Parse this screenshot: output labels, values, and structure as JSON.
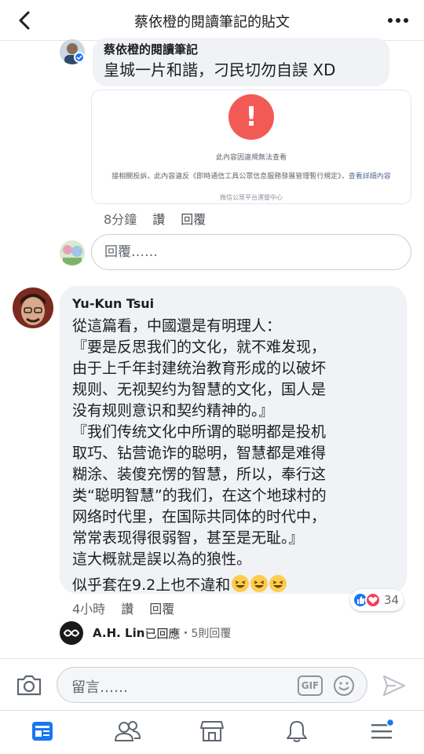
{
  "header": {
    "title": "蔡依橙的閱讀筆記的貼文"
  },
  "reply1": {
    "author": "蔡依橙的閱讀筆記",
    "text": "皇城一片和諧，刁民切勿自誤 XD",
    "embed": {
      "notice": "此內容因違規無法查看",
      "detail": "接相關投訴，此內容違反《即時通信工具公眾信息服務發展管理暫行規定》，",
      "detail_link": "查看詳細內容",
      "footer": "微信公眾平台運營中心"
    },
    "time": "8分鐘",
    "like_label": "讚",
    "reply_label": "回覆"
  },
  "reply_input": {
    "placeholder": "回覆……"
  },
  "comment": {
    "author": "Yu-Kun Tsui",
    "lines": [
      "從這篇看，中國還是有明理人：",
      "『要是反思我们的文化，就不难发现，",
      "由于上千年封建统治教育形成的以破坏",
      "规则、无视契约为智慧的文化，国人是",
      "没有规则意识和契约精神的。』",
      "『我们传统文化中所谓的聪明都是投机",
      "取巧、钻营诡诈的聪明，智慧都是难得",
      "糊涂、装傻充愣的智慧，所以，奉行这",
      "类“聪明智慧”的我们，在这个地球村的",
      "网络时代里，在国际共同体的时代中，",
      "常常表现得很弱智，甚至是无耻。』",
      "這大概就是誤以為的狼性。"
    ],
    "last_line": "似乎套在9.2上也不違和",
    "time": "4小時",
    "like_label": "讚",
    "reply_label": "回覆",
    "reaction_count": "34",
    "replies": {
      "name": "A.H. Lin",
      "action": "已回應",
      "count": "・5則回覆"
    }
  },
  "composer": {
    "placeholder": "留言……",
    "gif_label": "GIF"
  },
  "icons": {
    "back": "back-arrow-icon",
    "more": "more-dots-icon",
    "camera": "camera-icon",
    "gif": "gif-icon",
    "emoji": "emoji-icon",
    "send": "send-icon",
    "nav": [
      "news-feed-icon",
      "friends-icon",
      "marketplace-icon",
      "notifications-icon",
      "menu-icon"
    ]
  },
  "colors": {
    "accent": "#1877f2",
    "alert": "#f25a55",
    "love": "#f33e58",
    "bubble": "#f0f2f5"
  }
}
